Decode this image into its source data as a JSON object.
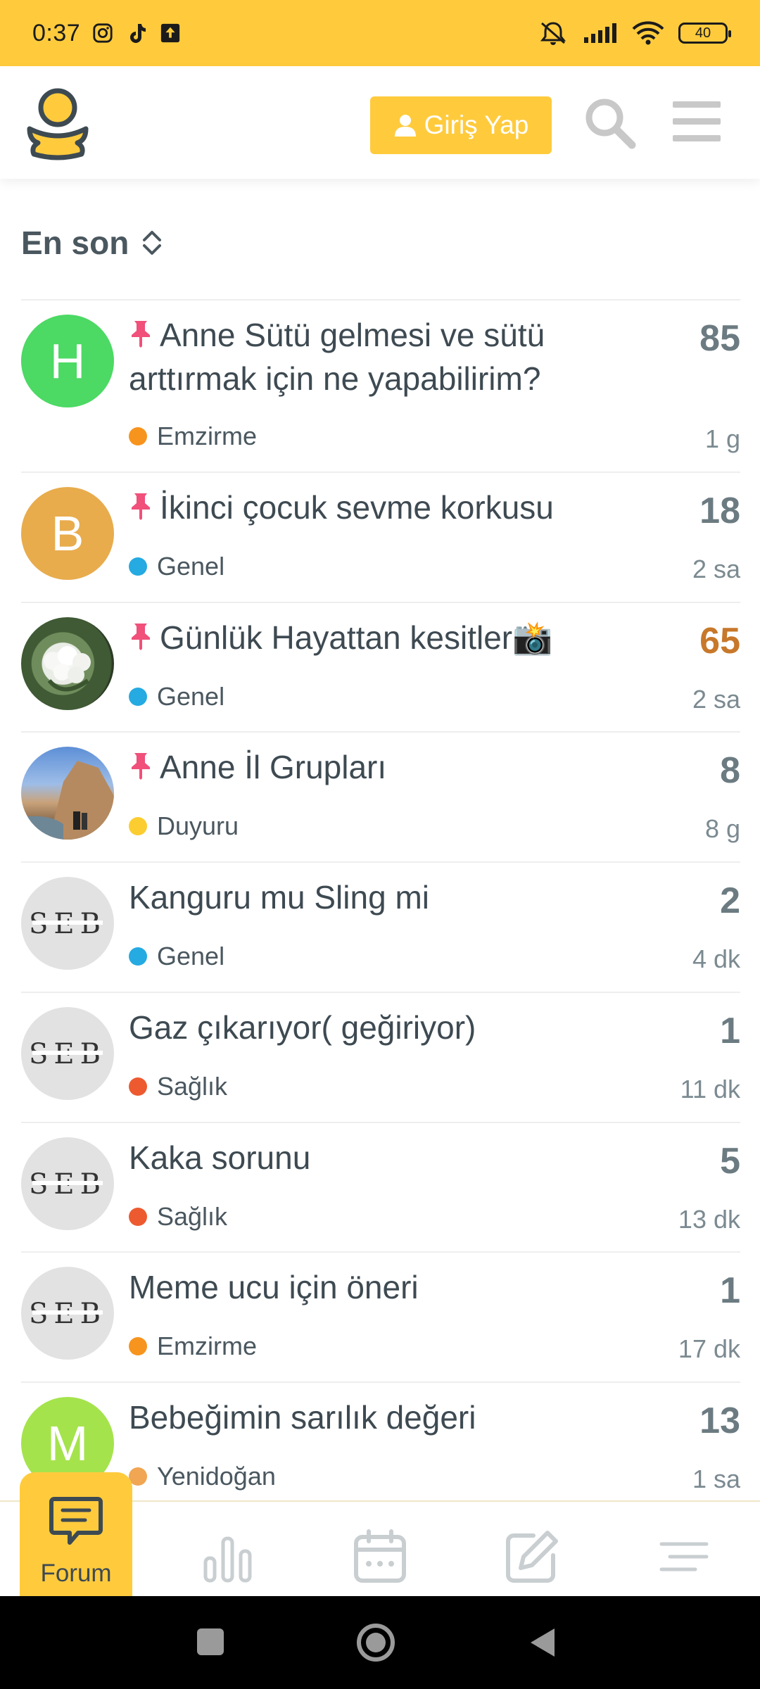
{
  "status_bar": {
    "time": "0:37",
    "battery": "40"
  },
  "header": {
    "login_label": "Giriş Yap"
  },
  "sort": {
    "label": "En son"
  },
  "topics": [
    {
      "title": "Anne Sütü gelmesi ve sütü arttırmak için ne yapabilirim?",
      "pinned": true,
      "avatar_letter": "H",
      "avatar_color": "#4cd964",
      "category": "Emzirme",
      "category_color": "#f7941d",
      "replies": "85",
      "age": "1 g"
    },
    {
      "title": "İkinci çocuk sevme korkusu",
      "pinned": true,
      "avatar_letter": "B",
      "avatar_color": "#e8ac4d",
      "category": "Genel",
      "category_color": "#25aae1",
      "replies": "18",
      "age": "2 sa"
    },
    {
      "title": "Günlük Hayattan kesitler📸",
      "pinned": true,
      "avatar_letter": "",
      "avatar_color": "#5e7a52",
      "category": "Genel",
      "category_color": "#25aae1",
      "replies": "65",
      "age": "2 sa",
      "hot": true
    },
    {
      "title": "Anne İl Grupları",
      "pinned": true,
      "avatar_letter": "",
      "avatar_color": "#6f8db0",
      "category": "Duyuru",
      "category_color": "#fbcd30",
      "replies": "8",
      "age": "8 g"
    },
    {
      "title": "Kanguru mu Sling mi",
      "pinned": false,
      "avatar_letter": "SEB",
      "avatar_color": "#e2e2e2",
      "category": "Genel",
      "category_color": "#25aae1",
      "replies": "2",
      "age": "4 dk"
    },
    {
      "title": "Gaz çıkarıyor( geğiriyor)",
      "pinned": false,
      "avatar_letter": "SEB",
      "avatar_color": "#e2e2e2",
      "category": "Sağlık",
      "category_color": "#ed5a30",
      "replies": "1",
      "age": "11 dk"
    },
    {
      "title": "Kaka sorunu",
      "pinned": false,
      "avatar_letter": "SEB",
      "avatar_color": "#e2e2e2",
      "category": "Sağlık",
      "category_color": "#ed5a30",
      "replies": "5",
      "age": "13 dk"
    },
    {
      "title": "Meme ucu için öneri",
      "pinned": false,
      "avatar_letter": "SEB",
      "avatar_color": "#e2e2e2",
      "category": "Emzirme",
      "category_color": "#f7941d",
      "replies": "1",
      "age": "17 dk"
    },
    {
      "title": "Bebeğimin sarılık değeri",
      "pinned": false,
      "avatar_letter": "M",
      "avatar_color": "#a5e34c",
      "category": "Yenidoğan",
      "category_color": "#f0a653",
      "replies": "13",
      "age": "1 sa"
    }
  ],
  "bottom_nav": {
    "forum_label": "Forum"
  },
  "colors": {
    "brand": "#ffcb3d",
    "text": "#3e4a52",
    "pin": "#f0507a"
  }
}
